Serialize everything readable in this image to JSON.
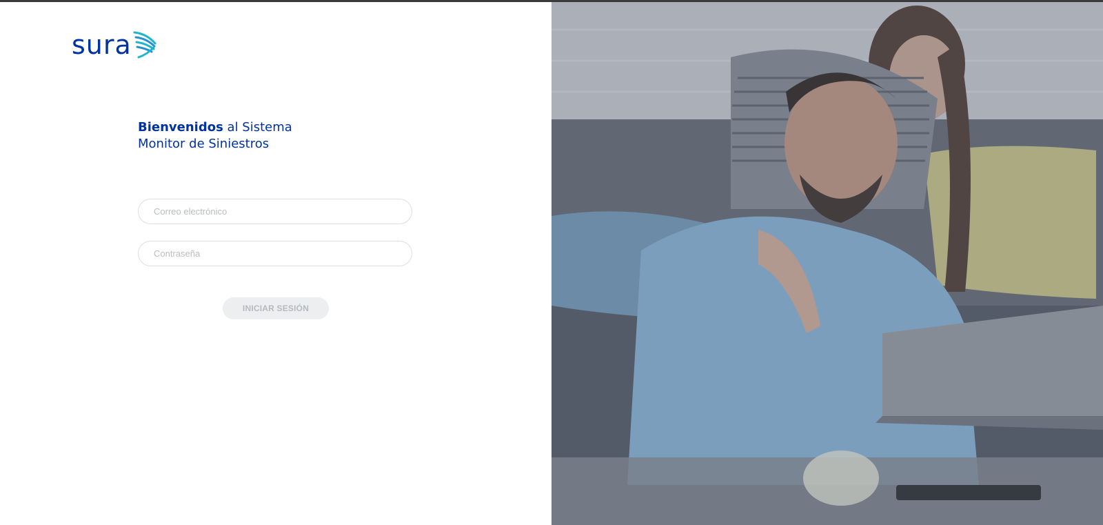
{
  "brand": {
    "logo_text": "sura"
  },
  "welcome": {
    "bold": "Bienvenidos",
    "line1_rest": " al Sistema",
    "line2": "Monitor de Siniestros"
  },
  "form": {
    "email_placeholder": "Correo electrónico",
    "password_placeholder": "Contraseña",
    "login_label": "INICIAR SESIÓN"
  },
  "hero": {
    "description": "photo",
    "icon": "hero-photo"
  },
  "colors": {
    "brand_blue": "#0033a0",
    "accent_teal": "#1cb5c9",
    "button_disabled_bg": "#eceef0"
  }
}
